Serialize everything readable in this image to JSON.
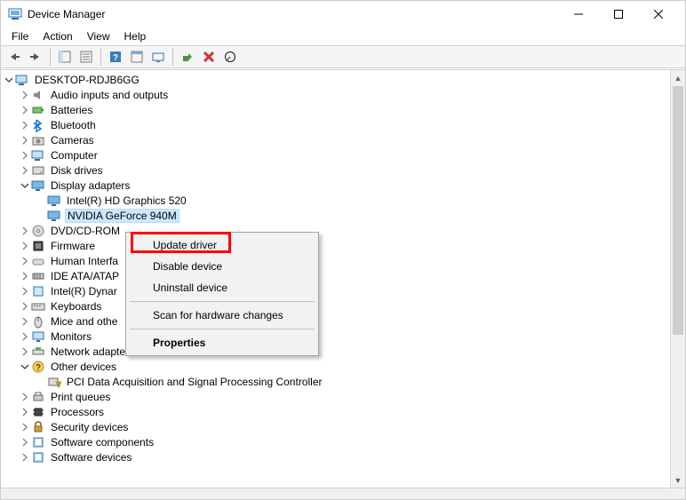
{
  "window": {
    "title": "Device Manager"
  },
  "menubar": [
    "File",
    "Action",
    "View",
    "Help"
  ],
  "tree": {
    "root": {
      "label": "DESKTOP-RDJB6GG",
      "icon": "computer",
      "expanded": true
    },
    "items": [
      {
        "label": "Audio inputs and outputs",
        "icon": "audio",
        "expander": "collapsed"
      },
      {
        "label": "Batteries",
        "icon": "battery",
        "expander": "collapsed"
      },
      {
        "label": "Bluetooth",
        "icon": "bluetooth",
        "expander": "collapsed"
      },
      {
        "label": "Cameras",
        "icon": "camera",
        "expander": "collapsed"
      },
      {
        "label": "Computer",
        "icon": "computer",
        "expander": "collapsed"
      },
      {
        "label": "Disk drives",
        "icon": "disk",
        "expander": "collapsed"
      },
      {
        "label": "Display adapters",
        "icon": "display",
        "expander": "expanded",
        "children": [
          {
            "label": "Intel(R) HD Graphics 520",
            "icon": "display"
          },
          {
            "label": "NVIDIA GeForce 940M",
            "icon": "display",
            "selected": true
          }
        ]
      },
      {
        "label": "DVD/CD-ROM",
        "icon": "dvd",
        "expander": "collapsed",
        "truncated": true
      },
      {
        "label": "Firmware",
        "icon": "firmware",
        "expander": "collapsed"
      },
      {
        "label": "Human Interfa",
        "icon": "hid",
        "expander": "collapsed",
        "truncated": true
      },
      {
        "label": "IDE ATA/ATAP",
        "icon": "ide",
        "expander": "collapsed",
        "truncated": true
      },
      {
        "label": "Intel(R) Dynar",
        "icon": "intel",
        "expander": "collapsed",
        "truncated": true
      },
      {
        "label": "Keyboards",
        "icon": "keyboard",
        "expander": "collapsed"
      },
      {
        "label": "Mice and othe",
        "icon": "mouse",
        "expander": "collapsed",
        "truncated": true
      },
      {
        "label": "Monitors",
        "icon": "monitor",
        "expander": "collapsed"
      },
      {
        "label": "Network adapters",
        "icon": "network",
        "expander": "collapsed"
      },
      {
        "label": "Other devices",
        "icon": "other",
        "expander": "expanded",
        "children": [
          {
            "label": "PCI Data Acquisition and Signal Processing Controller",
            "icon": "other-warn"
          }
        ]
      },
      {
        "label": "Print queues",
        "icon": "printer",
        "expander": "collapsed"
      },
      {
        "label": "Processors",
        "icon": "cpu",
        "expander": "collapsed"
      },
      {
        "label": "Security devices",
        "icon": "security",
        "expander": "collapsed"
      },
      {
        "label": "Software components",
        "icon": "software",
        "expander": "collapsed"
      },
      {
        "label": "Software devices",
        "icon": "software",
        "expander": "collapsed",
        "partial": true
      }
    ]
  },
  "context_menu": {
    "items": [
      {
        "label": "Update driver",
        "highlighted": true
      },
      {
        "label": "Disable device"
      },
      {
        "label": "Uninstall device"
      },
      {
        "sep": true
      },
      {
        "label": "Scan for hardware changes"
      },
      {
        "sep": true
      },
      {
        "label": "Properties",
        "bold": true
      }
    ]
  }
}
